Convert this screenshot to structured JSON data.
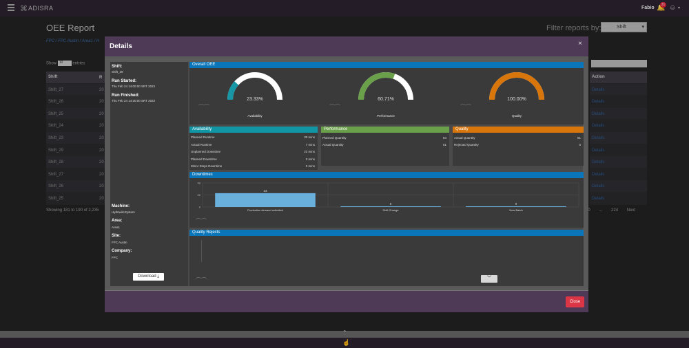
{
  "app": {
    "name": "ADISRA",
    "user": "Fabio",
    "notifications": "31"
  },
  "page": {
    "title": "OEE Report",
    "filter_label": "Filter reports by:",
    "filter_value": "Shift",
    "breadcrumb": "FPC / FPC Austin / Area1 / H",
    "show_label": "Show",
    "entries_value": "10",
    "entries_label": "entries",
    "showing": "Showing 181 to 190 of 2,235",
    "table": {
      "col_shift": "Shift",
      "col_r": "R",
      "col_action": "Action",
      "rows": [
        {
          "shift": "Shift_27",
          "v": "20",
          "action": "Details"
        },
        {
          "shift": "Shift_26",
          "v": "20",
          "action": "Details"
        },
        {
          "shift": "Shift_25",
          "v": "20",
          "action": "Details"
        },
        {
          "shift": "Shift_24",
          "v": "20",
          "action": "Details"
        },
        {
          "shift": "Shift_23",
          "v": "20",
          "action": "Details"
        },
        {
          "shift": "Shift_29",
          "v": "20",
          "action": "Details"
        },
        {
          "shift": "Shift_28",
          "v": "20",
          "action": "Details"
        },
        {
          "shift": "Shift_27",
          "v": "20",
          "action": "Details"
        },
        {
          "shift": "Shift_26",
          "v": "20",
          "action": "Details"
        },
        {
          "shift": "Shift_25",
          "v": "20",
          "action": "Details"
        }
      ]
    },
    "pager": {
      "first": "20",
      "ellipsis": "...",
      "last": "224",
      "next": "Next"
    }
  },
  "modal": {
    "title": "Details",
    "close_x": "×",
    "close_label": "Close",
    "download_label": "Download",
    "info": {
      "shift_label": "Shift:",
      "shift_value": "Shift_29",
      "started_label": "Run Started:",
      "started_value": "Thu Feb 24 14:00:00 SRT 2022",
      "finished_label": "Run Finished:",
      "finished_value": "Thu Feb 24 14:30:00 SRT 2022",
      "machine_label": "Machine:",
      "machine_value": "HydraulicSystem",
      "area_label": "Area:",
      "area_value": "Area1",
      "site_label": "Site:",
      "site_value": "FPC Austin",
      "company_label": "Company:",
      "company_value": "FPC"
    },
    "overall": {
      "title": "Overall OEE",
      "gauges": [
        {
          "label": "Availability",
          "value": "23.33%",
          "fraction": 0.2333,
          "color": "#1796a6"
        },
        {
          "label": "Performance",
          "value": "60.71%",
          "fraction": 0.6071,
          "color": "#6aa04a"
        },
        {
          "label": "Quality",
          "value": "100.00%",
          "fraction": 1.0,
          "color": "#d8760c"
        }
      ]
    },
    "availability": {
      "title": "Availability",
      "rows": [
        {
          "k": "Planned Runtime",
          "v": "30 mins"
        },
        {
          "k": "Actual Runtime",
          "v": "7 mins"
        },
        {
          "k": "Unplanned Downtime",
          "v": "23 mins"
        },
        {
          "k": "Planned Downtime",
          "v": "0 mins"
        },
        {
          "k": "Minor Stops Downtime",
          "v": "0 mins"
        }
      ]
    },
    "performance": {
      "title": "Performance",
      "rows": [
        {
          "k": "Planned Quantity",
          "v": "84"
        },
        {
          "k": "Actual Quantity",
          "v": "51"
        }
      ]
    },
    "quality": {
      "title": "Quality",
      "rows": [
        {
          "k": "Actual Quantity",
          "v": "51"
        },
        {
          "k": "Rejected Quantity",
          "v": "0"
        }
      ]
    },
    "downtimes_title": "Downtimes",
    "rejects_title": "Quality Rejects"
  },
  "chart_data": {
    "type": "bar",
    "categories": [
      "Production demand unlimited",
      "Shift Change",
      "New Batch"
    ],
    "values": [
      23,
      0,
      0
    ],
    "ylim": [
      0,
      40
    ],
    "yticks": [
      0,
      20,
      40
    ],
    "color": "#6ab0dc"
  }
}
